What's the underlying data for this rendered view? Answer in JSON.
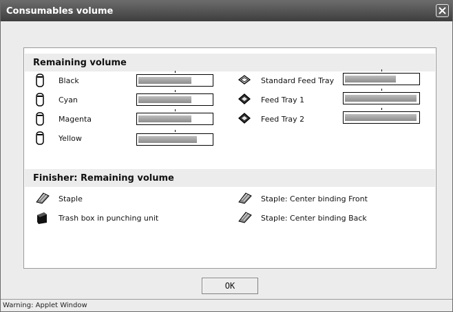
{
  "window": {
    "title": "Consumables volume"
  },
  "remaining": {
    "header": "Remaining volume",
    "toners": [
      {
        "label": "Black",
        "level": 0.73
      },
      {
        "label": "Cyan",
        "level": 0.73
      },
      {
        "label": "Magenta",
        "level": 0.73
      },
      {
        "label": "Yellow",
        "level": 0.8
      }
    ],
    "trays": [
      {
        "label": "Standard Feed Tray",
        "level": 0.7
      },
      {
        "label": "Feed Tray 1",
        "level": 0.98
      },
      {
        "label": "Feed Tray 2",
        "level": 0.98
      }
    ]
  },
  "finisher": {
    "header": "Finisher: Remaining volume",
    "left": [
      "Staple",
      "Trash box in punching unit"
    ],
    "right": [
      "Staple: Center binding Front",
      "Staple: Center binding Back"
    ]
  },
  "ok_label": "OK",
  "status": "Warning: Applet Window",
  "icons": {
    "toner": "toner-cartridge-icon",
    "tray": "paper-tray-icon",
    "staple": "stapler-icon",
    "trash": "trash-box-icon",
    "close": "close-icon"
  }
}
